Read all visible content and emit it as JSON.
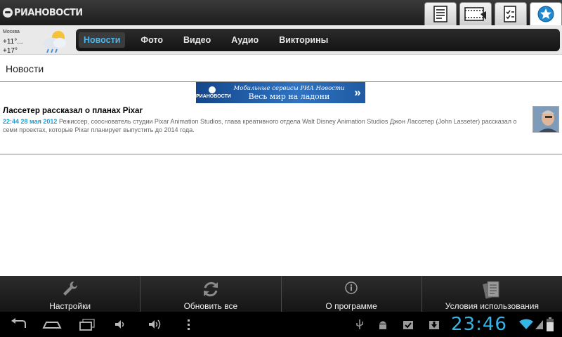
{
  "app": {
    "logo_text": "РИАНОВОСТИ"
  },
  "top_tabs": [
    {
      "icon": "news-list-icon",
      "active": false
    },
    {
      "icon": "video-film-icon",
      "active": false
    },
    {
      "icon": "quiz-checklist-icon",
      "active": false
    },
    {
      "icon": "favorites-star-icon",
      "active": true
    }
  ],
  "weather": {
    "city": "Москва",
    "temp_high": "+11°...",
    "temp_low": "+17°",
    "icon": "partly-cloudy-rain-icon"
  },
  "nav": {
    "items": [
      {
        "label": "Новости",
        "active": true
      },
      {
        "label": "Фото",
        "active": false
      },
      {
        "label": "Видео",
        "active": false
      },
      {
        "label": "Аудио",
        "active": false
      },
      {
        "label": "Викторины",
        "active": false
      }
    ]
  },
  "section": {
    "title": "Новости"
  },
  "banner": {
    "logo_text": "РИАНОВОСТИ",
    "line1": "Мобильные сервисы РИА Новости",
    "line2": "Весь мир на ладони",
    "arrow": "»"
  },
  "article": {
    "title": "Лассетер рассказал о планах Pixar",
    "date": "22:44 28 мая 2012",
    "summary": "Режиссер, сооснователь студии Pixar Animation Studios, глава креативного отдела Walt Disney Animation Studios Джон Лассетер (John Lasseter) рассказал о семи проектах, которые Pixar планирует выпустить до 2014 года."
  },
  "actions": [
    {
      "label": "Настройки",
      "icon": "wrench-icon"
    },
    {
      "label": "Обновить все",
      "icon": "refresh-icon"
    },
    {
      "label": "О программе",
      "icon": "info-icon"
    },
    {
      "label": "Условия использования",
      "icon": "documents-icon"
    }
  ],
  "system_bar": {
    "time": "23:46",
    "accent": "#33b5e5"
  }
}
